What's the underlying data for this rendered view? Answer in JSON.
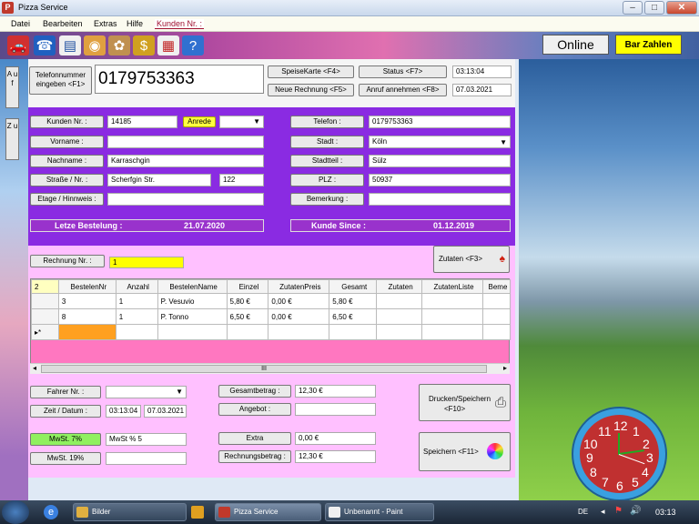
{
  "window": {
    "title": "Pizza Service"
  },
  "menu": {
    "datei": "Datei",
    "bearbeiten": "Bearbeiten",
    "extras": "Extras",
    "hilfe": "Hilfe",
    "kunden": "Kunden Nr. :"
  },
  "top": {
    "online": "Online",
    "bar_zahlen": "Bar Zahlen",
    "phone_btn_line1": "Telefonnummer",
    "phone_btn_line2": "eingeben <F1>",
    "phone_number": "0179753363",
    "speisekarte": "SpeiseKarte <F4>",
    "status": "Status <F7>",
    "neue_rechnung": "Neue Rechnung <F5>",
    "anruf": "Anruf annehmen <F8>",
    "time": "03:13:04",
    "date": "07.03.2021"
  },
  "side": {
    "auf": "A u f",
    "zu": "Z u"
  },
  "customer": {
    "kunden_nr_label": "Kunden Nr. :",
    "kunden_nr": "14185",
    "anrede_label": "Anrede",
    "anrede": "",
    "vorname_label": "Vorname :",
    "vorname": "",
    "nachname_label": "Nachname :",
    "nachname": "Karraschgin",
    "strasse_label": "Straße / Nr. :",
    "strasse": "Scherfgin Str.",
    "hausnr": "122",
    "etage_label": "Etage / Hinnweis :",
    "etage": "",
    "telefon_label": "Telefon :",
    "telefon": "0179753363",
    "stadt_label": "Stadt :",
    "stadt": "Köln",
    "stadtteil_label": "Stadtteil :",
    "stadtteil": "Sülz",
    "plz_label": "PLZ :",
    "plz": "50937",
    "bemerkung_label": "Bemerkung :",
    "bemerkung": "",
    "letzte_label": "Letze Bestelung :",
    "letzte": "21.07.2020",
    "kunde_since_label": "Kunde Since :",
    "kunde_since": "01.12.2019"
  },
  "order": {
    "rechnung_label": "Rechnung Nr. :",
    "rechnung": "1",
    "zutaten_btn": "Zutaten <F3>",
    "row_count": "2",
    "columns": [
      "BestelenNr",
      "Anzahl",
      "BestelenName",
      "Einzel",
      "ZutatenPreis",
      "Gesamt",
      "Zutaten",
      "ZutatenListe",
      "Beme"
    ],
    "rows": [
      [
        "3",
        "1",
        "P. Vesuvio",
        "5,80 €",
        "0,00 €",
        "5,80 €",
        "",
        "",
        ""
      ],
      [
        "8",
        "1",
        "P. Tonno",
        "6,50 €",
        "0,00 €",
        "6,50 €",
        "",
        "",
        ""
      ]
    ],
    "scroll_mid": "III"
  },
  "footer": {
    "fahrer_label": "Fahrer Nr. :",
    "fahrer": "",
    "zeit_label": "Zeit / Datum :",
    "zeit": "03:13:04",
    "datum": "07.03.2021",
    "mwst7_label": "MwSt.    7%",
    "mwst7": "MwSt % 5",
    "mwst19_label": "MwSt.   19%",
    "mwst19": "",
    "gesamt_label": "Gesamtbetrag :",
    "gesamt": "12,30 €",
    "angebot_label": "Angebot :",
    "angebot": "",
    "extra_label": "Extra",
    "extra": "0,00 €",
    "rechnungsbetrag_label": "Rechnungsbetrag :",
    "rechnungsbetrag": "12,30 €",
    "drucken_line1": "Drucken/Speichern",
    "drucken_line2": "<F10>",
    "speichern": "Speichern <F11>"
  },
  "clock": {
    "numbers": [
      "12",
      "1",
      "2",
      "3",
      "4",
      "5",
      "6",
      "7",
      "8",
      "9",
      "10",
      "11"
    ]
  },
  "taskbar": {
    "bilder": "Bilder",
    "pizza": "Pizza Service",
    "paint": "Unbenannt - Paint",
    "lang": "DE",
    "time": "03:13"
  },
  "colors": {
    "purple": "#8a2be2",
    "pink": "#ffc0ff",
    "yellow": "#ffff00",
    "bar_bg": "#9932cc"
  }
}
